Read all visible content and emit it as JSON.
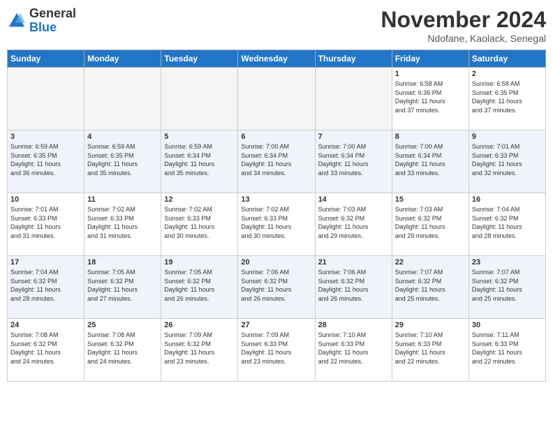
{
  "header": {
    "logo_general": "General",
    "logo_blue": "Blue",
    "month_title": "November 2024",
    "location": "Ndofane, Kaolack, Senegal"
  },
  "calendar": {
    "days_of_week": [
      "Sunday",
      "Monday",
      "Tuesday",
      "Wednesday",
      "Thursday",
      "Friday",
      "Saturday"
    ],
    "weeks": [
      [
        {
          "day": "",
          "info": ""
        },
        {
          "day": "",
          "info": ""
        },
        {
          "day": "",
          "info": ""
        },
        {
          "day": "",
          "info": ""
        },
        {
          "day": "",
          "info": ""
        },
        {
          "day": "1",
          "info": "Sunrise: 6:58 AM\nSunset: 6:36 PM\nDaylight: 11 hours\nand 37 minutes."
        },
        {
          "day": "2",
          "info": "Sunrise: 6:58 AM\nSunset: 6:35 PM\nDaylight: 11 hours\nand 37 minutes."
        }
      ],
      [
        {
          "day": "3",
          "info": "Sunrise: 6:59 AM\nSunset: 6:35 PM\nDaylight: 11 hours\nand 36 minutes."
        },
        {
          "day": "4",
          "info": "Sunrise: 6:59 AM\nSunset: 6:35 PM\nDaylight: 11 hours\nand 35 minutes."
        },
        {
          "day": "5",
          "info": "Sunrise: 6:59 AM\nSunset: 6:34 PM\nDaylight: 11 hours\nand 35 minutes."
        },
        {
          "day": "6",
          "info": "Sunrise: 7:00 AM\nSunset: 6:34 PM\nDaylight: 11 hours\nand 34 minutes."
        },
        {
          "day": "7",
          "info": "Sunrise: 7:00 AM\nSunset: 6:34 PM\nDaylight: 11 hours\nand 33 minutes."
        },
        {
          "day": "8",
          "info": "Sunrise: 7:00 AM\nSunset: 6:34 PM\nDaylight: 11 hours\nand 33 minutes."
        },
        {
          "day": "9",
          "info": "Sunrise: 7:01 AM\nSunset: 6:33 PM\nDaylight: 11 hours\nand 32 minutes."
        }
      ],
      [
        {
          "day": "10",
          "info": "Sunrise: 7:01 AM\nSunset: 6:33 PM\nDaylight: 11 hours\nand 31 minutes."
        },
        {
          "day": "11",
          "info": "Sunrise: 7:02 AM\nSunset: 6:33 PM\nDaylight: 11 hours\nand 31 minutes."
        },
        {
          "day": "12",
          "info": "Sunrise: 7:02 AM\nSunset: 6:33 PM\nDaylight: 11 hours\nand 30 minutes."
        },
        {
          "day": "13",
          "info": "Sunrise: 7:02 AM\nSunset: 6:33 PM\nDaylight: 11 hours\nand 30 minutes."
        },
        {
          "day": "14",
          "info": "Sunrise: 7:03 AM\nSunset: 6:32 PM\nDaylight: 11 hours\nand 29 minutes."
        },
        {
          "day": "15",
          "info": "Sunrise: 7:03 AM\nSunset: 6:32 PM\nDaylight: 11 hours\nand 29 minutes."
        },
        {
          "day": "16",
          "info": "Sunrise: 7:04 AM\nSunset: 6:32 PM\nDaylight: 11 hours\nand 28 minutes."
        }
      ],
      [
        {
          "day": "17",
          "info": "Sunrise: 7:04 AM\nSunset: 6:32 PM\nDaylight: 11 hours\nand 28 minutes."
        },
        {
          "day": "18",
          "info": "Sunrise: 7:05 AM\nSunset: 6:32 PM\nDaylight: 11 hours\nand 27 minutes."
        },
        {
          "day": "19",
          "info": "Sunrise: 7:05 AM\nSunset: 6:32 PM\nDaylight: 11 hours\nand 26 minutes."
        },
        {
          "day": "20",
          "info": "Sunrise: 7:06 AM\nSunset: 6:32 PM\nDaylight: 11 hours\nand 26 minutes."
        },
        {
          "day": "21",
          "info": "Sunrise: 7:06 AM\nSunset: 6:32 PM\nDaylight: 11 hours\nand 26 minutes."
        },
        {
          "day": "22",
          "info": "Sunrise: 7:07 AM\nSunset: 6:32 PM\nDaylight: 11 hours\nand 25 minutes."
        },
        {
          "day": "23",
          "info": "Sunrise: 7:07 AM\nSunset: 6:32 PM\nDaylight: 11 hours\nand 25 minutes."
        }
      ],
      [
        {
          "day": "24",
          "info": "Sunrise: 7:08 AM\nSunset: 6:32 PM\nDaylight: 11 hours\nand 24 minutes."
        },
        {
          "day": "25",
          "info": "Sunrise: 7:08 AM\nSunset: 6:32 PM\nDaylight: 11 hours\nand 24 minutes."
        },
        {
          "day": "26",
          "info": "Sunrise: 7:09 AM\nSunset: 6:32 PM\nDaylight: 11 hours\nand 23 minutes."
        },
        {
          "day": "27",
          "info": "Sunrise: 7:09 AM\nSunset: 6:33 PM\nDaylight: 11 hours\nand 23 minutes."
        },
        {
          "day": "28",
          "info": "Sunrise: 7:10 AM\nSunset: 6:33 PM\nDaylight: 11 hours\nand 22 minutes."
        },
        {
          "day": "29",
          "info": "Sunrise: 7:10 AM\nSunset: 6:33 PM\nDaylight: 11 hours\nand 22 minutes."
        },
        {
          "day": "30",
          "info": "Sunrise: 7:11 AM\nSunset: 6:33 PM\nDaylight: 11 hours\nand 22 minutes."
        }
      ]
    ]
  }
}
